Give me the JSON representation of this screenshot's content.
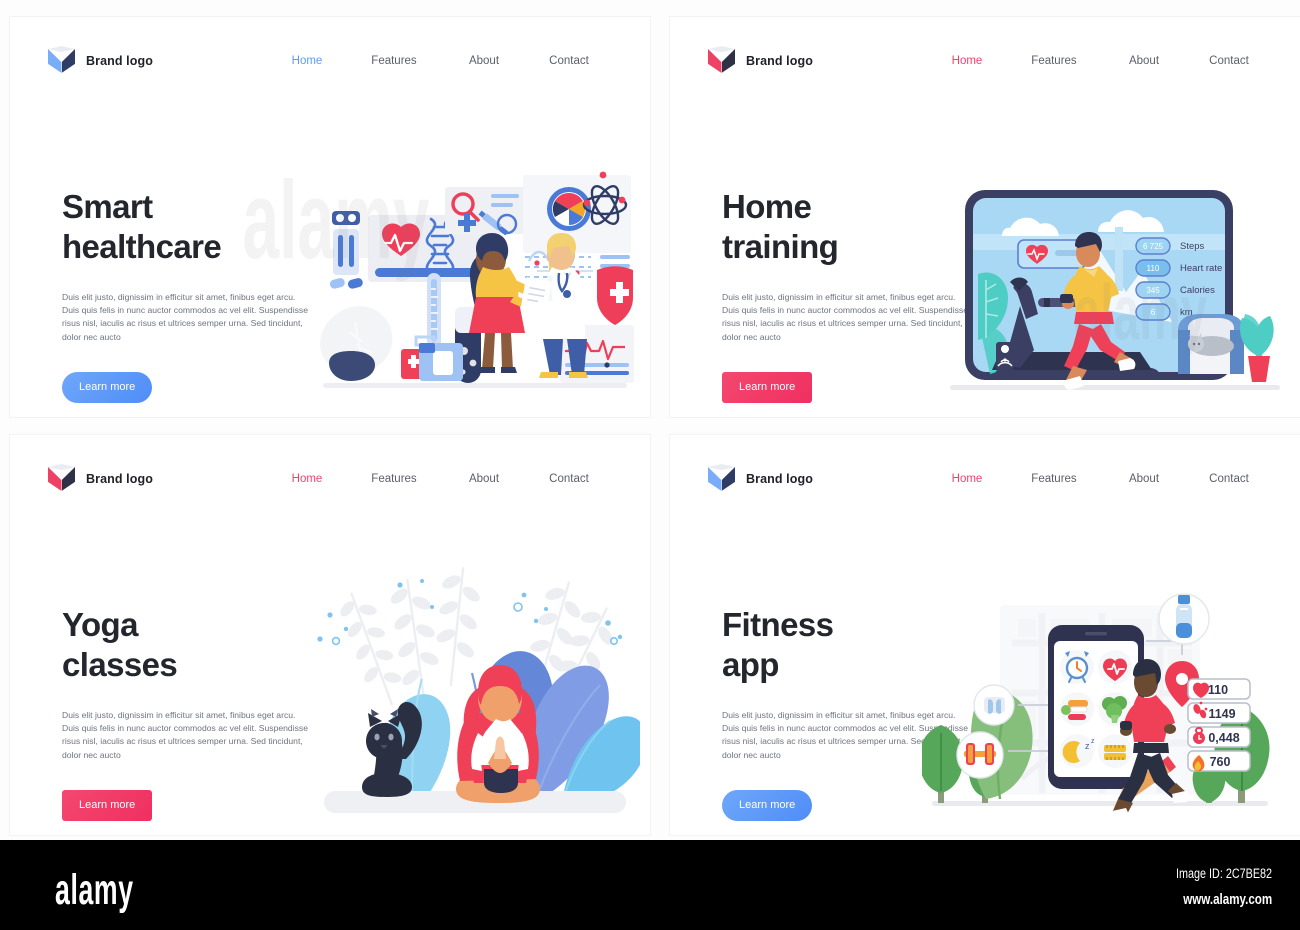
{
  "page": {
    "background": "#fdfdfd",
    "panel_background": "#ffffff"
  },
  "colors": {
    "blue_accent": "#5b9bf8",
    "blue_logo_light": "#a8c6f7",
    "blue_logo_dark": "#2f3d66",
    "pink_accent": "#f4406d",
    "pink_logo_light": "#f7a8bd",
    "pink_logo_dark": "#2f3246",
    "heading": "#24262e",
    "body_text": "#6d7380",
    "nav_text": "#5a5f6b"
  },
  "shared": {
    "brand_label": "Brand logo",
    "nav_items": [
      "Home",
      "Features",
      "About",
      "Contact"
    ],
    "cta_label": "Learn more",
    "body_copy": "Duis elit justo, dignissim in efficitur sit amet, finibus eget arcu. Duis quis felis in nunc auctor commodos ac vel elit. Suspendisse risus nisl, iaculis ac risus et ultrices semper urna. Sed tincidunt, dolor nec aucto"
  },
  "panels": [
    {
      "id": "smart-healthcare",
      "heading_line1": "Smart",
      "heading_line2": "healthcare",
      "accent": "#5b9bf8",
      "logo_light": "#a8c6f7",
      "logo_dark": "#2f3d66",
      "button_shape": "round",
      "active_nav": "Home",
      "illustration": {
        "name": "smart-healthcare-illustration",
        "elements": [
          "heart-pulse-icon",
          "dna-helix-icon",
          "magnifier-icon",
          "syringe-icon",
          "cross-icon",
          "atom-icon",
          "pie-chart-icon",
          "shield-cross-icon",
          "thermometer-icon",
          "test-tube-icon",
          "first-aid-kit-icon",
          "ecg-chart",
          "patient-character",
          "doctor-character",
          "pills-icon",
          "monstera-leaf"
        ]
      }
    },
    {
      "id": "home-training",
      "heading_line1": "Home",
      "heading_line2": "training",
      "accent": "#f4406d",
      "logo_light": "#f7a8bd",
      "logo_dark": "#2f3246",
      "button_shape": "sharp",
      "active_nav": "Home",
      "illustration": {
        "name": "home-training-illustration",
        "screen_stats": [
          {
            "label": "Steps",
            "value": "6 725"
          },
          {
            "label": "Heart rate",
            "value": "110"
          },
          {
            "label": "Calories",
            "value": "345"
          },
          {
            "label": "km",
            "value": "6"
          }
        ],
        "elements": [
          "treadmill",
          "runner-character",
          "heart-monitor-widget",
          "sleeping-cat",
          "armchair",
          "potted-plant",
          "speaker-icon",
          "clouds"
        ]
      }
    },
    {
      "id": "yoga-classes",
      "heading_line1": "Yoga",
      "heading_line2": "classes",
      "accent": "#f4406d",
      "logo_light": "#f7a8bd",
      "logo_dark": "#2f3246",
      "button_shape": "sharp",
      "active_nav": "Home",
      "illustration": {
        "name": "yoga-classes-illustration",
        "elements": [
          "meditating-woman",
          "black-cat",
          "blue-leaves",
          "fern-branches",
          "bubble-dots"
        ]
      }
    },
    {
      "id": "fitness-app",
      "heading_line1": "Fitness",
      "heading_line2": "app",
      "accent": "#5b9bf8",
      "logo_light": "#a8c6f7",
      "logo_dark": "#2f3d66",
      "button_shape": "round",
      "active_nav": "Home",
      "illustration": {
        "name": "fitness-app-illustration",
        "phone_app_icons": [
          "alarm-clock-icon",
          "heart-pulse-icon",
          "diet-food-icon",
          "broccoli-icon",
          "sleep-moon-icon",
          "measuring-tape-icon"
        ],
        "stat_badges": [
          {
            "icon": "heart-icon",
            "value": "110"
          },
          {
            "icon": "footsteps-icon",
            "value": "1149"
          },
          {
            "icon": "stopwatch-icon",
            "value": "0,448"
          },
          {
            "icon": "flame-icon",
            "value": "760"
          }
        ],
        "accessory_badges": [
          "earbuds-icon",
          "dumbbell-icon",
          "water-bottle-icon"
        ],
        "elements": [
          "smartphone",
          "running-woman",
          "map-pin-icon",
          "trees",
          "map-background"
        ]
      }
    }
  ],
  "footer": {
    "logo_text": "alamy",
    "image_id": "Image ID: 2C7BE82",
    "url": "www.alamy.com"
  },
  "watermark": {
    "text": "alamy"
  }
}
